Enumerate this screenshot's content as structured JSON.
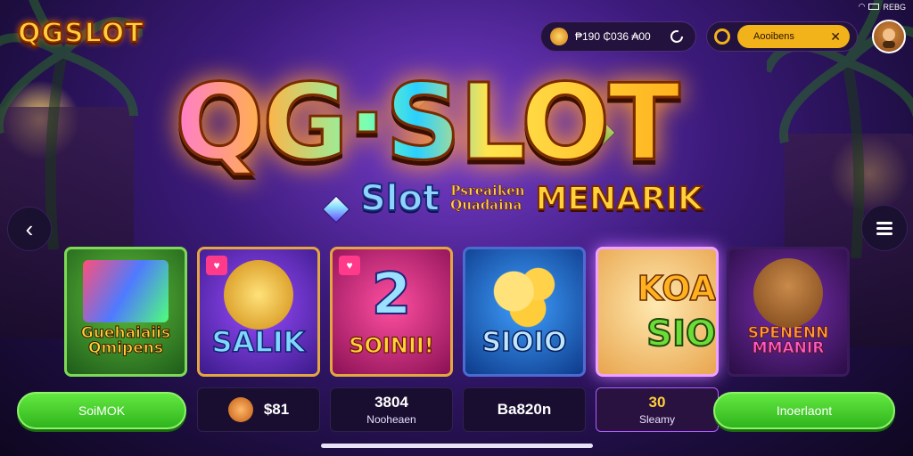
{
  "header": {
    "logo": "QGSLOT",
    "balance": "₱190 ₵036 ₳00",
    "search_field": "Aooibens",
    "status_right": "REBG"
  },
  "hero": {
    "title": "QG·SLOT",
    "sub_slot": "Slot",
    "sub_small_1": "Psreaiken",
    "sub_small_2": "Quadaina",
    "sub_menarik": "MENARIK"
  },
  "tiles": [
    {
      "label_1": "Guehaiaiis",
      "label_2": "Qmipens"
    },
    {
      "label": "SALIK"
    },
    {
      "label": "SOINII!"
    },
    {
      "label": "SIOIO"
    },
    {
      "label_1": "KOA",
      "label_2": "SIO"
    },
    {
      "label_1": "SPENENN",
      "label_2": "MMANIR"
    }
  ],
  "bottom": {
    "left_button": "SoiMOK",
    "stat_1": "$81",
    "stat_2_value": "3804",
    "stat_2_label": "Nooheaen",
    "stat_3": "Ba820n",
    "stat_4_value": "30",
    "stat_4_label": "Sleamy",
    "right_button": "Inoerlaont"
  },
  "colors": {
    "accent_gold": "#ffcf3a",
    "button_green": "#3fcf2a",
    "background_purple": "#3b1a7a"
  },
  "icons": [
    "back-icon",
    "menu-icon",
    "refresh-icon",
    "coin-icon",
    "close-icon",
    "avatar",
    "wifi-icon",
    "battery-icon"
  ]
}
